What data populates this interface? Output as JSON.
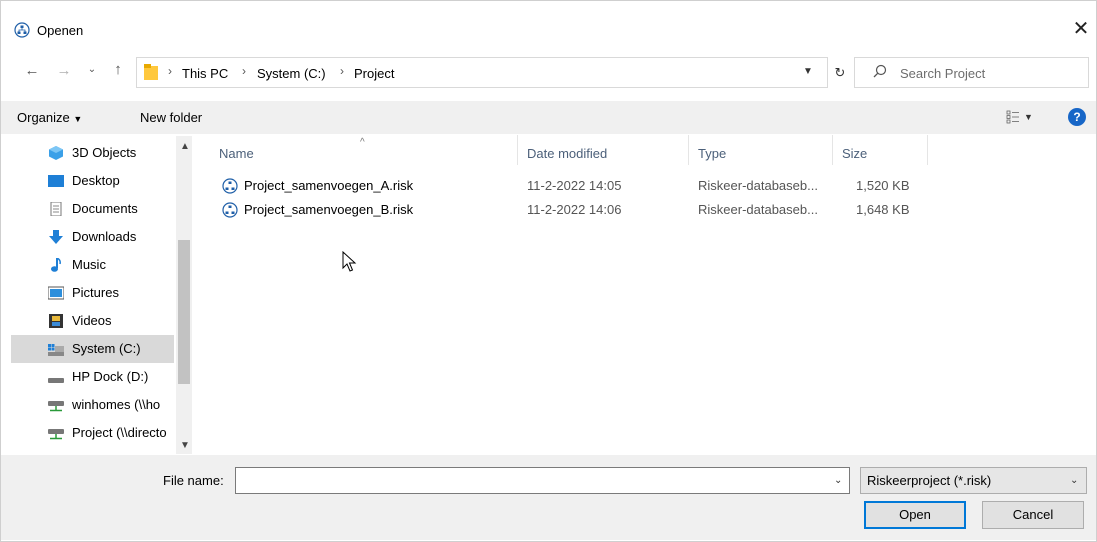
{
  "window": {
    "title": "Openen",
    "close_glyph": "✕"
  },
  "address": {
    "breadcrumbs": [
      "This PC",
      "System (C:)",
      "Project"
    ],
    "search_placeholder": "Search Project"
  },
  "toolbar": {
    "organize_label": "Organize",
    "new_folder_label": "New folder",
    "help_label": "?"
  },
  "sidebar": {
    "items": [
      {
        "label": "3D Objects",
        "icon": "3d-objects-icon"
      },
      {
        "label": "Desktop",
        "icon": "desktop-icon"
      },
      {
        "label": "Documents",
        "icon": "documents-icon"
      },
      {
        "label": "Downloads",
        "icon": "downloads-icon"
      },
      {
        "label": "Music",
        "icon": "music-icon"
      },
      {
        "label": "Pictures",
        "icon": "pictures-icon"
      },
      {
        "label": "Videos",
        "icon": "videos-icon"
      },
      {
        "label": "System (C:)",
        "icon": "drive-icon",
        "selected": true
      },
      {
        "label": "HP Dock (D:)",
        "icon": "drive-icon"
      },
      {
        "label": "winhomes (\\\\ho",
        "icon": "network-drive-icon"
      },
      {
        "label": "Project (\\\\directo",
        "icon": "network-drive-icon"
      }
    ]
  },
  "file_list": {
    "columns": [
      "Name",
      "Date modified",
      "Type",
      "Size"
    ],
    "rows": [
      {
        "name": "Project_samenvoegen_A.risk",
        "date": "11-2-2022 14:05",
        "type": "Riskeer-databaseb...",
        "size": "1,520 KB"
      },
      {
        "name": "Project_samenvoegen_B.risk",
        "date": "11-2-2022 14:06",
        "type": "Riskeer-databaseb...",
        "size": "1,648 KB"
      }
    ]
  },
  "footer": {
    "file_name_label": "File name:",
    "file_name_value": "",
    "file_type": "Riskeerproject (*.risk)",
    "open_label": "Open",
    "cancel_label": "Cancel"
  },
  "colors": {
    "accent": "#0078d7",
    "folder": "#ffc83d",
    "help": "#1766c7"
  }
}
